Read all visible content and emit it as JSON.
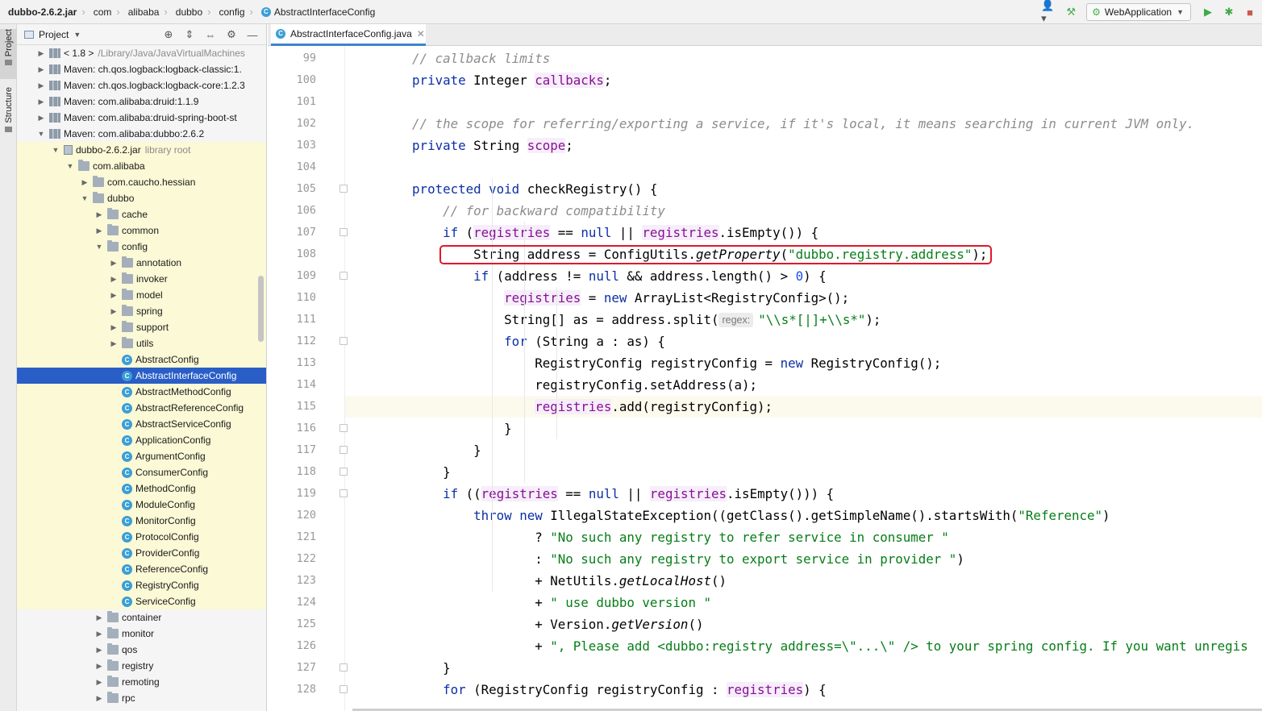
{
  "breadcrumb": {
    "items": [
      "dubbo-2.6.2.jar",
      "com",
      "alibaba",
      "dubbo",
      "config",
      "AbstractInterfaceConfig"
    ],
    "class_badge": "C"
  },
  "toolbar": {
    "run_config": "WebApplication"
  },
  "left_stripe": {
    "project_label": "Project",
    "structure_label": "Structure"
  },
  "project_panel": {
    "title": "Project",
    "tree": [
      {
        "label": "< 1.8 >",
        "sub": "/Library/Java/JavaVirtualMachines",
        "icon": "lib",
        "twisty": "▶"
      },
      {
        "label": "Maven: ch.qos.logback:logback-classic:1.",
        "sub": "",
        "icon": "lib",
        "twisty": "▶"
      },
      {
        "label": "Maven: ch.qos.logback:logback-core:1.2.3",
        "sub": "",
        "icon": "lib",
        "twisty": "▶"
      },
      {
        "label": "Maven: com.alibaba:druid:1.1.9",
        "sub": "",
        "icon": "lib",
        "twisty": "▶"
      },
      {
        "label": "Maven: com.alibaba:druid-spring-boot-st",
        "sub": "",
        "icon": "lib",
        "twisty": "▶"
      },
      {
        "label": "Maven: com.alibaba:dubbo:2.6.2",
        "sub": "",
        "icon": "lib",
        "twisty": "▼"
      },
      {
        "label": "dubbo-2.6.2.jar",
        "sub": "library root",
        "icon": "jar",
        "twisty": "▼"
      },
      {
        "label": "com.alibaba",
        "sub": "",
        "icon": "folder",
        "twisty": "▼"
      },
      {
        "label": "com.caucho.hessian",
        "sub": "",
        "icon": "folder",
        "twisty": "▶"
      },
      {
        "label": "dubbo",
        "sub": "",
        "icon": "folder",
        "twisty": "▼"
      },
      {
        "label": "cache",
        "sub": "",
        "icon": "folder",
        "twisty": "▶"
      },
      {
        "label": "common",
        "sub": "",
        "icon": "folder",
        "twisty": "▶"
      },
      {
        "label": "config",
        "sub": "",
        "icon": "folder",
        "twisty": "▼"
      },
      {
        "label": "annotation",
        "sub": "",
        "icon": "folder",
        "twisty": "▶"
      },
      {
        "label": "invoker",
        "sub": "",
        "icon": "folder",
        "twisty": "▶"
      },
      {
        "label": "model",
        "sub": "",
        "icon": "folder",
        "twisty": "▶"
      },
      {
        "label": "spring",
        "sub": "",
        "icon": "folder",
        "twisty": "▶"
      },
      {
        "label": "support",
        "sub": "",
        "icon": "folder",
        "twisty": "▶"
      },
      {
        "label": "utils",
        "sub": "",
        "icon": "folder",
        "twisty": "▶"
      },
      {
        "label": "AbstractConfig",
        "sub": "",
        "icon": "cls",
        "twisty": ""
      },
      {
        "label": "AbstractInterfaceConfig",
        "sub": "",
        "icon": "cls",
        "twisty": ""
      },
      {
        "label": "AbstractMethodConfig",
        "sub": "",
        "icon": "cls",
        "twisty": ""
      },
      {
        "label": "AbstractReferenceConfig",
        "sub": "",
        "icon": "cls",
        "twisty": ""
      },
      {
        "label": "AbstractServiceConfig",
        "sub": "",
        "icon": "cls",
        "twisty": ""
      },
      {
        "label": "ApplicationConfig",
        "sub": "",
        "icon": "cls",
        "twisty": ""
      },
      {
        "label": "ArgumentConfig",
        "sub": "",
        "icon": "cls",
        "twisty": ""
      },
      {
        "label": "ConsumerConfig",
        "sub": "",
        "icon": "cls",
        "twisty": ""
      },
      {
        "label": "MethodConfig",
        "sub": "",
        "icon": "cls",
        "twisty": ""
      },
      {
        "label": "ModuleConfig",
        "sub": "",
        "icon": "cls",
        "twisty": ""
      },
      {
        "label": "MonitorConfig",
        "sub": "",
        "icon": "cls",
        "twisty": ""
      },
      {
        "label": "ProtocolConfig",
        "sub": "",
        "icon": "cls",
        "twisty": ""
      },
      {
        "label": "ProviderConfig",
        "sub": "",
        "icon": "cls",
        "twisty": ""
      },
      {
        "label": "ReferenceConfig",
        "sub": "",
        "icon": "cls",
        "twisty": ""
      },
      {
        "label": "RegistryConfig",
        "sub": "",
        "icon": "cls",
        "twisty": ""
      },
      {
        "label": "ServiceConfig",
        "sub": "",
        "icon": "cls",
        "twisty": ""
      },
      {
        "label": "container",
        "sub": "",
        "icon": "folder",
        "twisty": "▶"
      },
      {
        "label": "monitor",
        "sub": "",
        "icon": "folder",
        "twisty": "▶"
      },
      {
        "label": "qos",
        "sub": "",
        "icon": "folder",
        "twisty": "▶"
      },
      {
        "label": "registry",
        "sub": "",
        "icon": "folder",
        "twisty": "▶"
      },
      {
        "label": "remoting",
        "sub": "",
        "icon": "folder",
        "twisty": "▶"
      },
      {
        "label": "rpc",
        "sub": "",
        "icon": "folder",
        "twisty": "▶"
      }
    ],
    "selected_item": "AbstractInterfaceConfig"
  },
  "editor": {
    "tab_label": "AbstractInterfaceConfig.java",
    "first_line": 99,
    "current_line": 115,
    "highlighted_line": 108,
    "regex_hint": "regex:",
    "lines": [
      [
        [
          "    ",
          "t"
        ],
        [
          "// callback limits",
          "cm"
        ]
      ],
      [
        [
          "    ",
          "t"
        ],
        [
          "private",
          "kw"
        ],
        [
          " Integer ",
          "t"
        ],
        [
          "callbacks",
          "fld"
        ],
        [
          ";",
          "t"
        ]
      ],
      [],
      [
        [
          "    ",
          "t"
        ],
        [
          "// the scope for referring/exporting a service, if it's local, it means searching in current JVM only.",
          "cm"
        ]
      ],
      [
        [
          "    ",
          "t"
        ],
        [
          "private",
          "kw"
        ],
        [
          " String ",
          "t"
        ],
        [
          "scope",
          "fld"
        ],
        [
          ";",
          "t"
        ]
      ],
      [],
      [
        [
          "    ",
          "t"
        ],
        [
          "protected void",
          "kw"
        ],
        [
          " checkRegistry() {",
          "t"
        ]
      ],
      [
        [
          "        ",
          "t"
        ],
        [
          "// for backward compatibility",
          "cm"
        ]
      ],
      [
        [
          "        ",
          "t"
        ],
        [
          "if",
          "kw"
        ],
        [
          " (",
          "t"
        ],
        [
          "registries",
          "fld"
        ],
        [
          " == ",
          "t"
        ],
        [
          "null",
          "kw"
        ],
        [
          " || ",
          "t"
        ],
        [
          "registries",
          "fld"
        ],
        [
          ".isEmpty()) {",
          "t"
        ]
      ],
      [
        [
          "            ",
          "t"
        ],
        [
          "String address = ConfigUtils.",
          "t"
        ],
        [
          "getProperty",
          "it"
        ],
        [
          "(",
          "t"
        ],
        [
          "\"dubbo.registry.address\"",
          "st"
        ],
        [
          ");",
          "t"
        ]
      ],
      [
        [
          "            ",
          "t"
        ],
        [
          "if",
          "kw"
        ],
        [
          " (address != ",
          "t"
        ],
        [
          "null",
          "kw"
        ],
        [
          " && address.length() > ",
          "t"
        ],
        [
          "0",
          "num"
        ],
        [
          ") {",
          "t"
        ]
      ],
      [
        [
          "                ",
          "t"
        ],
        [
          "registries",
          "fld"
        ],
        [
          " = ",
          "t"
        ],
        [
          "new",
          "kw"
        ],
        [
          " ArrayList<RegistryConfig>();",
          "t"
        ]
      ],
      [
        [
          "                ",
          "t"
        ],
        [
          "String[] as = address.split(",
          "t"
        ],
        [
          "regex:",
          "hint"
        ],
        [
          "\"\\\\s*[|]+\\\\s*\"",
          "st"
        ],
        [
          ");",
          "t"
        ]
      ],
      [
        [
          "                ",
          "t"
        ],
        [
          "for",
          "kw"
        ],
        [
          " (String a : as) {",
          "t"
        ]
      ],
      [
        [
          "                    ",
          "t"
        ],
        [
          "RegistryConfig registryConfig = ",
          "t"
        ],
        [
          "new",
          "kw"
        ],
        [
          " RegistryConfig();",
          "t"
        ]
      ],
      [
        [
          "                    ",
          "t"
        ],
        [
          "registryConfig.setAddress(a);",
          "t"
        ]
      ],
      [
        [
          "                    ",
          "t"
        ],
        [
          "registries",
          "fld"
        ],
        [
          ".add(registryConfig);",
          "t"
        ]
      ],
      [
        [
          "                ",
          "t"
        ],
        [
          "}",
          "t"
        ]
      ],
      [
        [
          "            ",
          "t"
        ],
        [
          "}",
          "t"
        ]
      ],
      [
        [
          "        ",
          "t"
        ],
        [
          "}",
          "t"
        ]
      ],
      [
        [
          "        ",
          "t"
        ],
        [
          "if",
          "kw"
        ],
        [
          " ((",
          "t"
        ],
        [
          "registries",
          "fld"
        ],
        [
          " == ",
          "t"
        ],
        [
          "null",
          "kw"
        ],
        [
          " || ",
          "t"
        ],
        [
          "registries",
          "fld"
        ],
        [
          ".isEmpty())) {",
          "t"
        ]
      ],
      [
        [
          "            ",
          "t"
        ],
        [
          "throw new",
          "kw"
        ],
        [
          " IllegalStateException((getClass().getSimpleName().startsWith(",
          "t"
        ],
        [
          "\"Reference\"",
          "st"
        ],
        [
          ")",
          "t"
        ]
      ],
      [
        [
          "                    ",
          "t"
        ],
        [
          "? ",
          "t"
        ],
        [
          "\"No such any registry to refer service in consumer \"",
          "st"
        ]
      ],
      [
        [
          "                    ",
          "t"
        ],
        [
          ": ",
          "t"
        ],
        [
          "\"No such any registry to export service in provider \"",
          "st"
        ],
        [
          ")",
          "t"
        ]
      ],
      [
        [
          "                    ",
          "t"
        ],
        [
          "+ NetUtils.",
          "t"
        ],
        [
          "getLocalHost",
          "it"
        ],
        [
          "()",
          "t"
        ]
      ],
      [
        [
          "                    ",
          "t"
        ],
        [
          "+ ",
          "t"
        ],
        [
          "\" use dubbo version \"",
          "st"
        ]
      ],
      [
        [
          "                    ",
          "t"
        ],
        [
          "+ Version.",
          "t"
        ],
        [
          "getVersion",
          "it"
        ],
        [
          "()",
          "t"
        ]
      ],
      [
        [
          "                    ",
          "t"
        ],
        [
          "+ ",
          "t"
        ],
        [
          "\", Please add <dubbo:registry address=\\\"...\\\" /> to your spring config. If you want unregis",
          "st"
        ]
      ],
      [
        [
          "        ",
          "t"
        ],
        [
          "}",
          "t"
        ]
      ],
      [
        [
          "        ",
          "t"
        ],
        [
          "for",
          "kw"
        ],
        [
          " (RegistryConfig registryConfig : ",
          "t"
        ],
        [
          "registries",
          "fld"
        ],
        [
          ") {",
          "t"
        ]
      ]
    ]
  },
  "colors": {
    "selection": "#2a5ec7",
    "keyword": "#0b2fa4",
    "string": "#067d17",
    "field": "#871094",
    "comment": "#8c8c8c",
    "highlight_box": "#e0182a"
  }
}
